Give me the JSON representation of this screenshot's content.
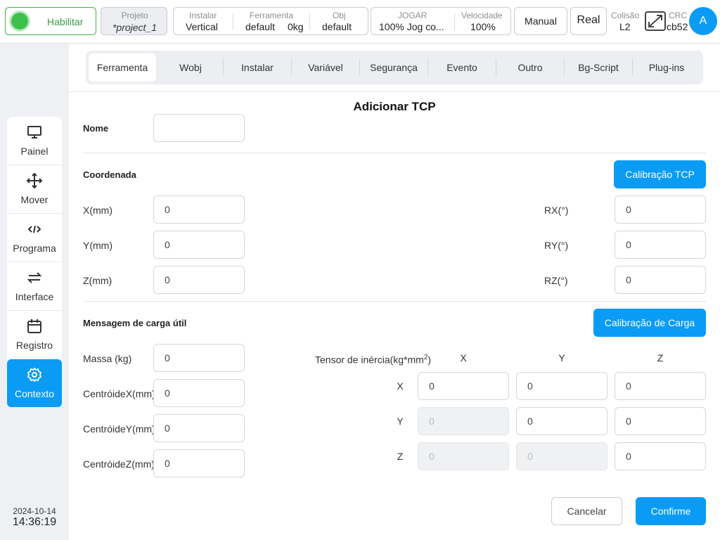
{
  "topbar": {
    "enable_label": "Habilitar",
    "project": {
      "label": "Projeto",
      "value": "*project_1"
    },
    "install": {
      "label": "Instalar",
      "value": "Vertical"
    },
    "tool": {
      "label": "Ferramenta",
      "value": "default",
      "load": "0kg"
    },
    "obj": {
      "label": "Obj",
      "value": "default"
    },
    "jog": {
      "label": "JOGAR",
      "value": "100%  Jog co..."
    },
    "speed": {
      "label": "Velocidade",
      "value": "100%"
    },
    "manual_label": "Manual",
    "real_label": "Real",
    "collision": {
      "label": "Colisão",
      "value": "L2"
    },
    "crc": {
      "label": "CRC",
      "value": "cb52"
    },
    "avatar_letter": "A",
    "colors": {
      "enable": "#3ec04d",
      "accent": "#0a9cf5"
    }
  },
  "sidebar": {
    "items": [
      {
        "label": "Painel",
        "icon": "monitor-icon"
      },
      {
        "label": "Mover",
        "icon": "move-arrows-icon"
      },
      {
        "label": "Programa",
        "icon": "code-icon"
      },
      {
        "label": "Interface",
        "icon": "swap-arrows-icon"
      },
      {
        "label": "Registro",
        "icon": "calendar-icon"
      },
      {
        "label": "Contexto",
        "icon": "gear-icon",
        "active": true
      }
    ],
    "date": "2024-10-14",
    "time": "14:36:19"
  },
  "tabs": [
    "Ferramenta",
    "Wobj",
    "Instalar",
    "Variável",
    "Segurança",
    "Evento",
    "Outro",
    "Bg-Script",
    "Plug-ins"
  ],
  "form": {
    "title": "Adicionar TCP",
    "name_label": "Nome",
    "name_value": "",
    "coord_label": "Coordenada",
    "tcp_calib_button": "Calibração TCP",
    "x_label": "X(mm)",
    "x_value": "0",
    "y_label": "Y(mm)",
    "y_value": "0",
    "z_label": "Z(mm)",
    "z_value": "0",
    "rx_label": "RX(°)",
    "rx_value": "0",
    "ry_label": "RY(°)",
    "ry_value": "0",
    "rz_label": "RZ(°)",
    "rz_value": "0",
    "payload_label": "Mensagem de carga útil",
    "load_calib_button": "Calibração de Carga",
    "mass_label": "Massa (kg)",
    "mass_value": "0",
    "cx_label": "CentróideX(mm)",
    "cx_value": "0",
    "cy_label": "CentróideY(mm)",
    "cy_value": "0",
    "cz_label": "CentróideZ(mm)",
    "cz_value": "0",
    "inertia_label": "Tensor de inércia(kg*mm",
    "inertia_exp": "2",
    "inertia_label_end": ")",
    "col_x": "X",
    "col_y": "Y",
    "col_z": "Z",
    "row_x": "X",
    "row_y": "Y",
    "row_z": "Z",
    "ixx": "0",
    "ixy": "0",
    "ixz": "0",
    "iyx": "0",
    "iyy": "0",
    "iyz": "0",
    "izx": "0",
    "izy": "0",
    "izz": "0",
    "cancel_button": "Cancelar",
    "confirm_button": "Confirme"
  }
}
